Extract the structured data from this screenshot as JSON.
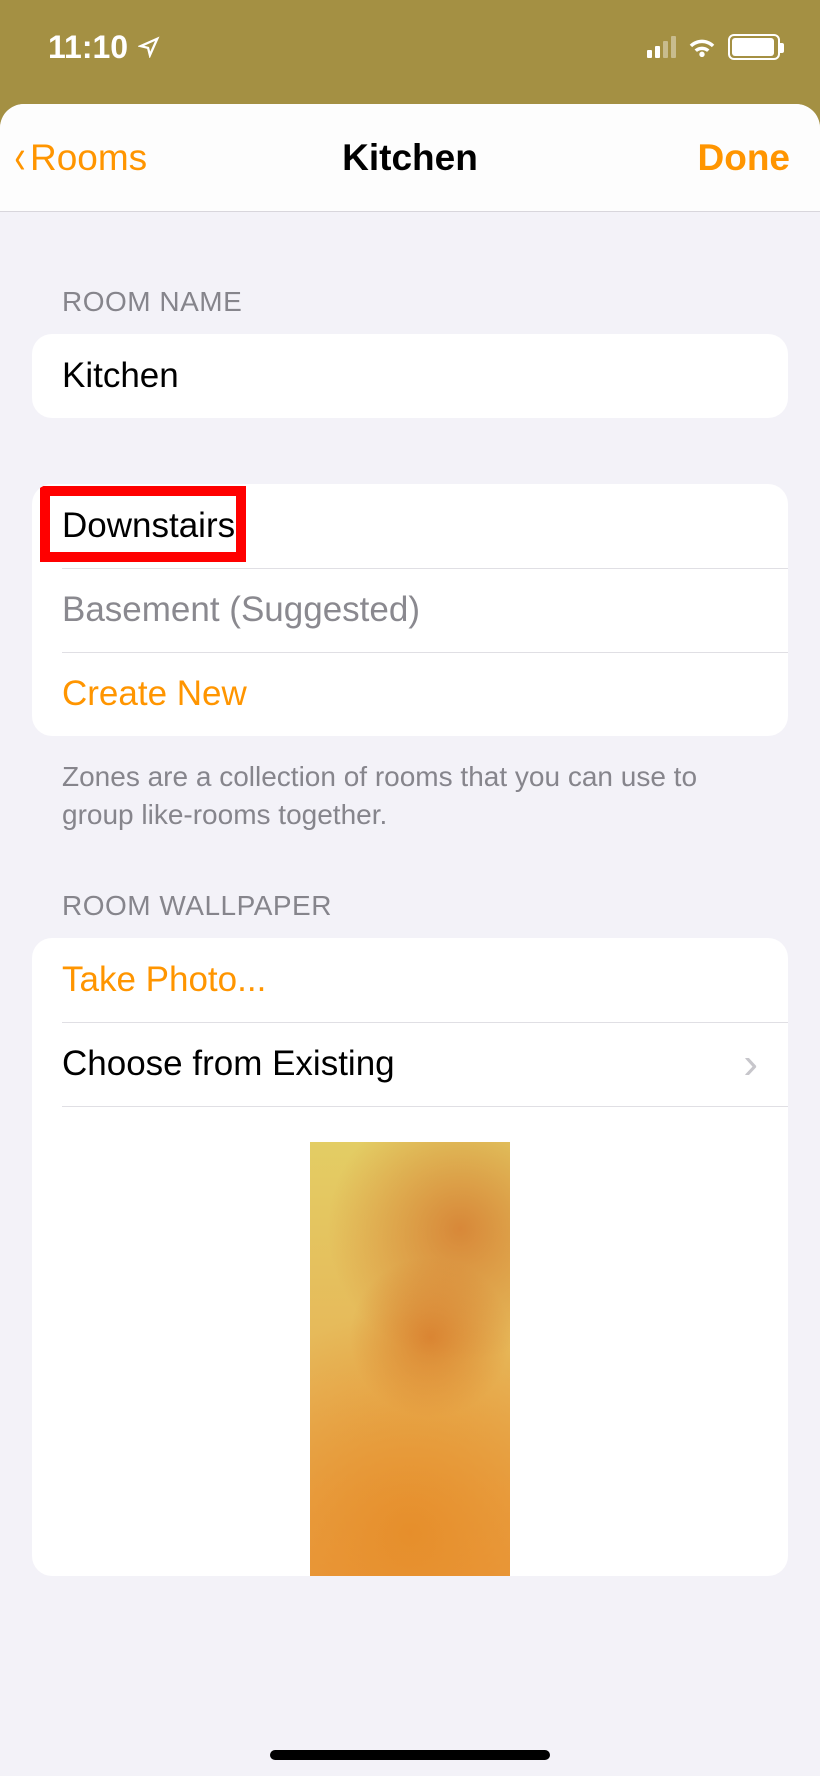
{
  "statusbar": {
    "time": "11:10"
  },
  "navbar": {
    "back_label": "Rooms",
    "title": "Kitchen",
    "done_label": "Done"
  },
  "room_name": {
    "header": "ROOM NAME",
    "value": "Kitchen"
  },
  "zones": {
    "items": [
      {
        "label": "Downstairs",
        "highlighted": true
      },
      {
        "label": "Basement (Suggested)",
        "suggested": true
      }
    ],
    "create_label": "Create New",
    "footer": "Zones are a collection of rooms that you can use to group like-rooms together."
  },
  "wallpaper": {
    "header": "ROOM WALLPAPER",
    "take_photo_label": "Take Photo...",
    "choose_existing_label": "Choose from Existing"
  },
  "colors": {
    "accent": "#ff9500",
    "bg": "#f3f2f8"
  }
}
